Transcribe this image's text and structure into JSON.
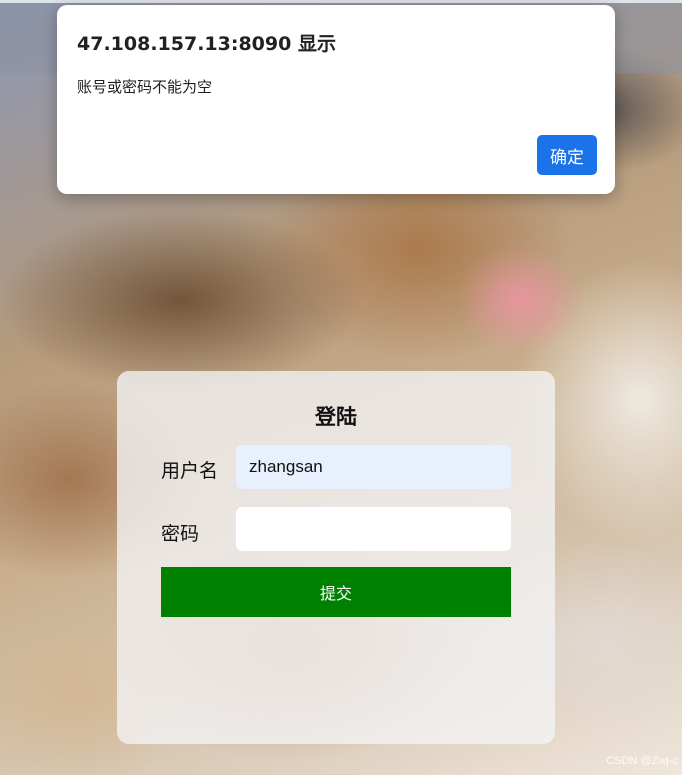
{
  "dialog": {
    "title": "47.108.157.13:8090 显示",
    "message": "账号或密码不能为空",
    "ok_label": "确定"
  },
  "login": {
    "title": "登陆",
    "username_label": "用户名",
    "username_value": "zhangsan",
    "password_label": "密码",
    "password_value": "",
    "submit_label": "提交"
  },
  "watermark": "CSDN @Zwj-c",
  "colors": {
    "dialog_button": "#1a73e8",
    "submit_button": "#008000",
    "autofill_input": "#e8f0fe"
  }
}
